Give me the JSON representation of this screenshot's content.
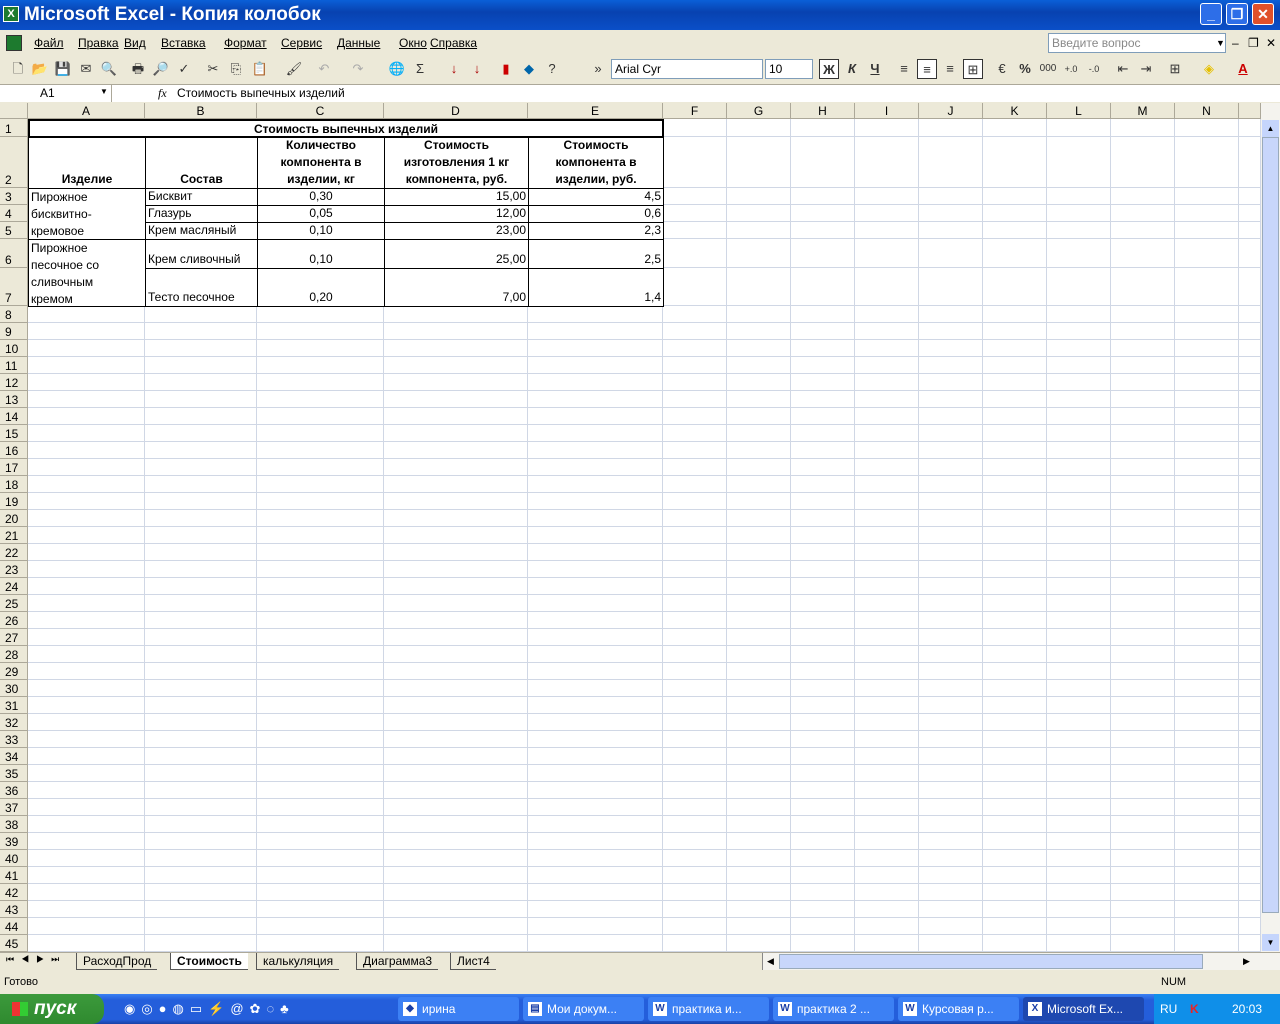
{
  "window": {
    "title": "Microsoft Excel - Копия колобок"
  },
  "menu": [
    "Файл",
    "Правка",
    "Вид",
    "Вставка",
    "Формат",
    "Сервис",
    "Данные",
    "Окно",
    "Справка"
  ],
  "help_placeholder": "Введите вопрос",
  "toolbar": {
    "font": "Arial Cyr",
    "size": "10",
    "bold": "Ж",
    "italic": "К",
    "underline": "Ч",
    "percent": "%",
    "thousands": "000",
    "sigma": "Σ"
  },
  "formula": {
    "name_box": "A1",
    "fx": "fx",
    "value": "Стоимость выпечных изделий"
  },
  "columns": [
    "A",
    "B",
    "C",
    "D",
    "E",
    "F",
    "G",
    "H",
    "I",
    "J",
    "K",
    "L",
    "M",
    "N"
  ],
  "sheet": {
    "title": "Стоимость выпечных изделий",
    "headers": [
      "Изделие",
      "Состав",
      "Количество компонента в изделии, кг",
      "Стоимость изготовления 1 кг компонента, руб.",
      "Стоимость компонента в изделии, руб."
    ],
    "products": [
      "Пирожное бисквитно-кремовое",
      "Пирожное песочное со сливочным кремом"
    ],
    "rows": [
      [
        "Бисквит",
        "0,30",
        "15,00",
        "4,5"
      ],
      [
        "Глазурь",
        "0,05",
        "12,00",
        "0,6"
      ],
      [
        "Крем масляный",
        "0,10",
        "23,00",
        "2,3"
      ],
      [
        "Крем сливочный",
        "0,10",
        "25,00",
        "2,5"
      ],
      [
        "Тесто песочное",
        "0,20",
        "7,00",
        "1,4"
      ]
    ]
  },
  "tabs": [
    "РасходПрод",
    "Стоимость",
    "калькуляция",
    "Диаграмма3",
    "Лист4"
  ],
  "active_tab": 1,
  "status": {
    "left": "Готово",
    "num": "NUM"
  },
  "taskbar": {
    "start": "пуск",
    "tasks": [
      "ирина",
      "Мои докум...",
      "практика и...",
      "практика 2 ...",
      "Курсовая р...",
      "Microsoft Ex..."
    ],
    "lang": "RU",
    "clock": "20:03"
  }
}
